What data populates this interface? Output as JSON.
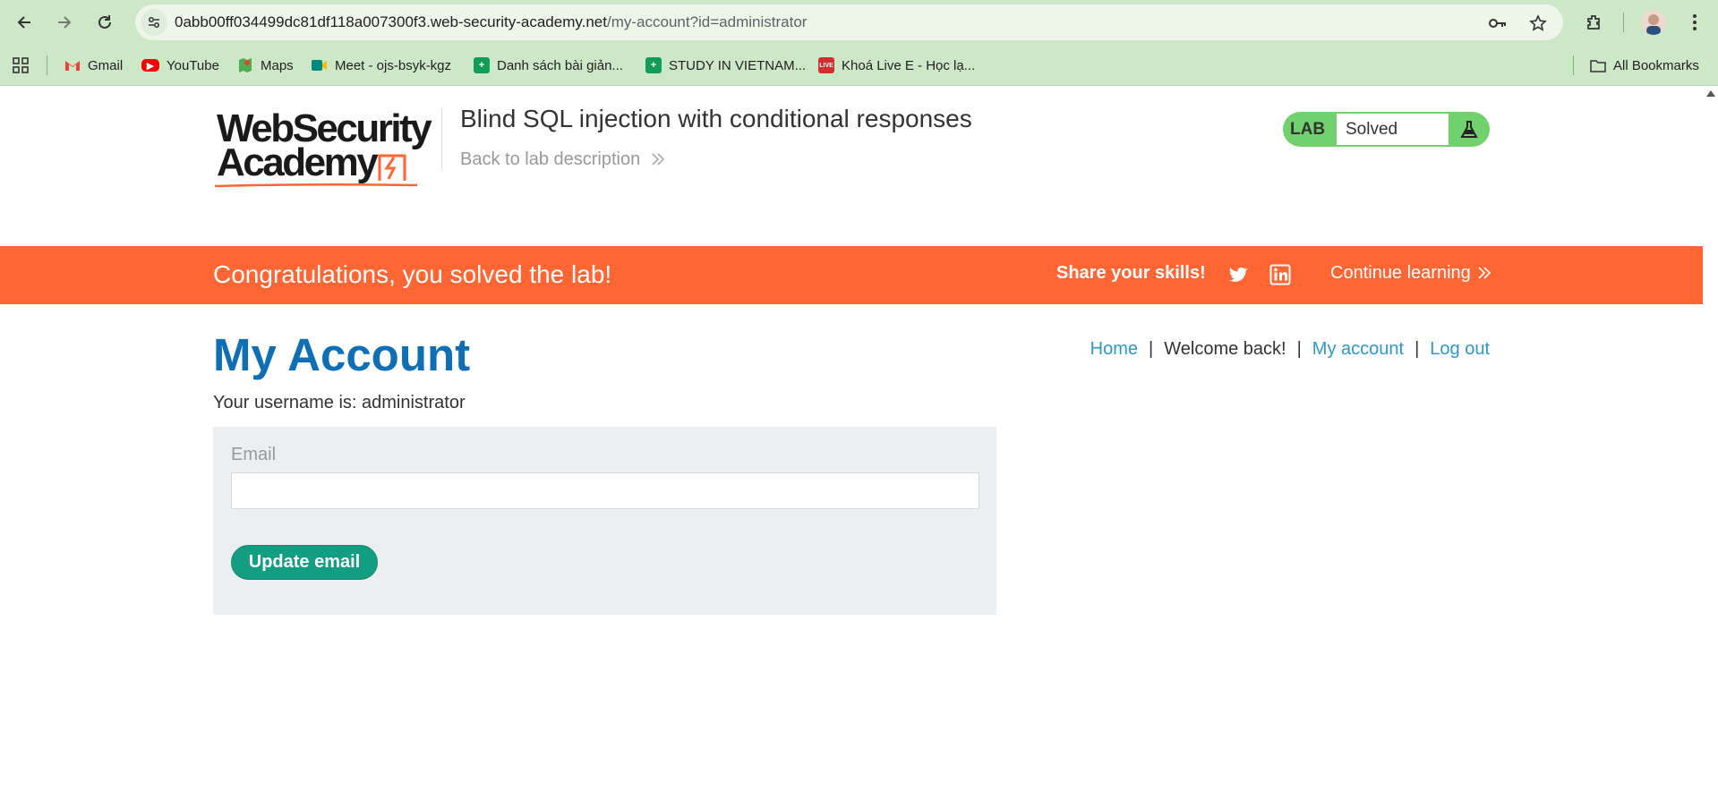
{
  "browser": {
    "url_host": "0abb00ff034499dc81df118a007300f3.web-security-academy.net",
    "url_path": "/my-account?id=administrator",
    "icons": [
      "back-icon",
      "forward-icon",
      "reload-icon",
      "site-info-icon",
      "password-key-icon",
      "bookmark-star-icon",
      "extensions-icon",
      "profile-avatar",
      "menu-dots-icon"
    ],
    "bookmarks": [
      {
        "label": "Gmail",
        "icon": "gmail-icon",
        "color": "#ea4335"
      },
      {
        "label": "YouTube",
        "icon": "youtube-icon",
        "color": "#ff0000"
      },
      {
        "label": "Maps",
        "icon": "maps-icon",
        "color": "#34a853"
      },
      {
        "label": "Meet - ojs-bsyk-kgz",
        "icon": "meet-icon",
        "color": "#00897b"
      },
      {
        "label": "Danh sách bài giản...",
        "icon": "sheets-icon",
        "color": "#0f9d58"
      },
      {
        "label": "STUDY IN VIETNAM...",
        "icon": "sheets-icon",
        "color": "#0f9d58"
      },
      {
        "label": "Khoá Live E - Học lạ...",
        "icon": "red-favicon",
        "color": "#d32f2f"
      }
    ],
    "all_bookmarks": "All Bookmarks"
  },
  "header": {
    "logo_line1": "WebSecurity",
    "logo_line2": "Academy",
    "lab_title": "Blind SQL injection with conditional responses",
    "back_link": "Back to lab description",
    "lab_badge_label": "LAB",
    "lab_status": "Solved"
  },
  "banner": {
    "congrats": "Congratulations, you solved the lab!",
    "share": "Share your skills!",
    "continue": "Continue learning"
  },
  "nav": {
    "home": "Home",
    "welcome": "Welcome back!",
    "my_account": "My account",
    "logout": "Log out"
  },
  "main": {
    "heading": "My Account",
    "username_line": "Your username is: administrator",
    "email_label": "Email",
    "email_value": "",
    "update_button": "Update email"
  },
  "colors": {
    "chrome": "#cde8c7",
    "accent_orange": "#ff6633",
    "heading_blue": "#0f6fb4",
    "link_blue": "#2f98c4",
    "button_green": "#139e82",
    "lab_green": "#70d16d"
  }
}
